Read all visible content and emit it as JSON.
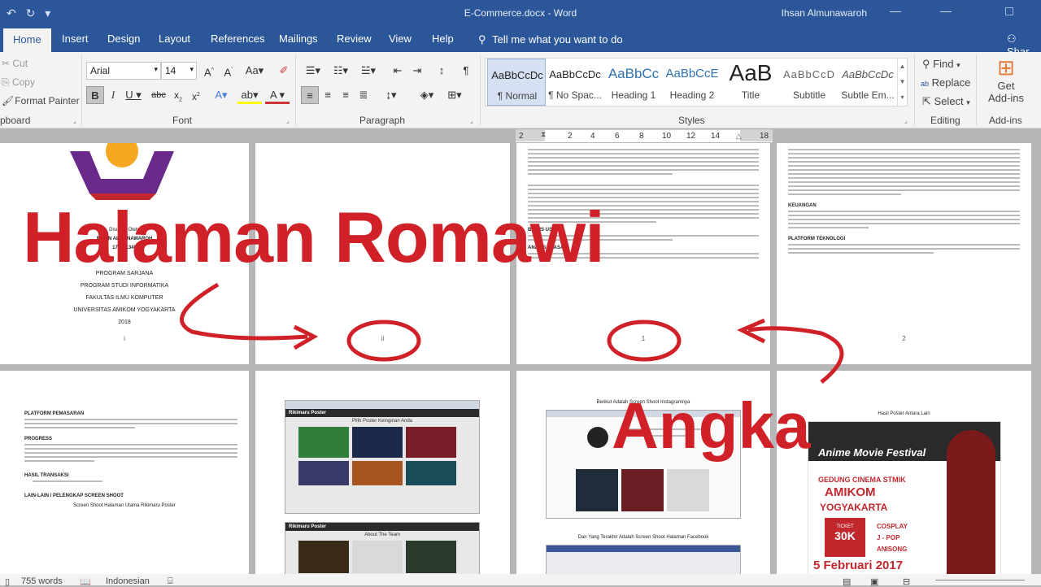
{
  "title_bar": {
    "doc_title": "E-Commerce.docx - Word",
    "user": "Ihsan Almunawaroh"
  },
  "tabs": [
    "Home",
    "Insert",
    "Design",
    "Layout",
    "References",
    "Mailings",
    "Review",
    "View",
    "Help"
  ],
  "tell_me": "Tell me what you want to do",
  "share": "Shar",
  "clipboard": {
    "cut": "Cut",
    "copy": "Copy",
    "format_painter": "Format Painter",
    "label": "pboard"
  },
  "font": {
    "name": "Arial",
    "size": "14",
    "label": "Font"
  },
  "paragraph": {
    "label": "Paragraph"
  },
  "styles": {
    "label": "Styles",
    "items": [
      {
        "preview": "AaBbCcDc",
        "name": "¶ Normal"
      },
      {
        "preview": "AaBbCcDc",
        "name": "¶ No Spac..."
      },
      {
        "preview": "AaBbCc",
        "name": "Heading 1"
      },
      {
        "preview": "AaBbCcE",
        "name": "Heading 2"
      },
      {
        "preview": "AaB",
        "name": "Title"
      },
      {
        "preview": "AaBbCcD",
        "name": "Subtitle"
      },
      {
        "preview": "AaBbCcDc",
        "name": "Subtle Em..."
      }
    ]
  },
  "editing": {
    "find": "Find",
    "replace": "Replace",
    "select": "Select",
    "label": "Editing"
  },
  "addins": {
    "get": "Get",
    "addins_btn": "Add-ins",
    "label": "Add-ins"
  },
  "ruler": [
    "2",
    "2",
    "4",
    "6",
    "8",
    "10",
    "12",
    "14",
    "18"
  ],
  "pages": {
    "p1": {
      "lines": [
        "Disusun Oleh:",
        "IHSAN ALMUNAWAROH",
        "17.11.1348",
        "PROGRAM SARJANA",
        "PROGRAM STUDI INFORMATIKA",
        "FAKULTAS ILMU KOMPUTER",
        "UNIVERSITAS AMIKOM YOGYAKARTA",
        "2018"
      ],
      "num": "i"
    },
    "p2": {
      "num": "ii"
    },
    "p3": {
      "h1": "BISNIS USAHA",
      "h2": "ANALISA PASAR",
      "num": "1"
    },
    "p4": {
      "h1": "KEUANGAN",
      "h2": "PLATFORM TEKNOLOGI",
      "num": "2"
    },
    "p5": {
      "headings": [
        "PLATFORM PEMASARAN",
        "PROGRESS",
        "HASIL TRANSAKSI",
        "LAIN-LAIN / PELENGKAP SCREEN SHOOT"
      ],
      "caption": "Screen Shoot Halaman Utama Rikimaru Poster"
    },
    "p6": {
      "site": "Rikimaru Poster",
      "heading": "Pilih Poster Keinginan Anda",
      "about": "About The Team"
    },
    "p7": {
      "caption1": "Berikut Adalah Screen Shoot Instagramnya",
      "caption2": "Dan Yang Terakhir Adalah Screen Shoot Halaman Facebook"
    },
    "p8": {
      "caption": "Hasil Poster Antara Lain",
      "poster_title": "Anime Movie Festival",
      "venue": "GEDUNG CINEMA STMIK",
      "org": "AMIKOM",
      "city": "YOGYAKARTA",
      "ticket": "TICKET",
      "price": "30K",
      "events": [
        "COSPLAY",
        "J - POP",
        "ANISONG"
      ],
      "date": "5 Februari 2017"
    }
  },
  "overlay": {
    "title": "Halaman Romawi",
    "angka": "Angka"
  },
  "status": {
    "words": "755 words",
    "language": "Indonesian"
  },
  "colors": {
    "word_blue": "#2b579a",
    "annotation_red": "#d12128"
  }
}
